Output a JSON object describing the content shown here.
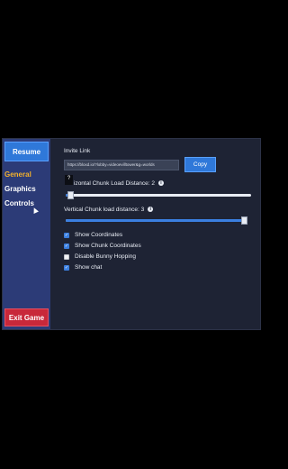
{
  "sidebar": {
    "resume_label": "Resume",
    "items": [
      {
        "label": "General",
        "active": true
      },
      {
        "label": "Graphics",
        "active": false
      },
      {
        "label": "Controls",
        "active": false
      }
    ],
    "exit_label": "Exit Game"
  },
  "invite": {
    "label": "Invite Link",
    "url": "https://bloxd.io/?lobby=videoevilltower&g=worlds",
    "copy_label": "Copy"
  },
  "settings": {
    "horizontal": {
      "label": "Horizontal Chunk Load Distance: 2",
      "visible_label": "izontal Chunk Load Distance: 2",
      "fill": 0.01
    },
    "vertical": {
      "label": "Vertical Chunk load distance: 3",
      "fill": 1.0
    },
    "info_glyph": "i",
    "tooltip_glyph": "?"
  },
  "checkboxes": [
    {
      "label": "Show Coordinates",
      "checked": true
    },
    {
      "label": "Show Chunk Coordinates",
      "checked": true
    },
    {
      "label": "Disable Bunny Hopping",
      "checked": false
    },
    {
      "label": "Show chat",
      "checked": true
    }
  ],
  "colors": {
    "accent": "#3b7fe0",
    "exit": "#c8283a",
    "active_nav": "#f3b12c",
    "panel": "#1e2334",
    "sidebar": "#2c3b77"
  }
}
